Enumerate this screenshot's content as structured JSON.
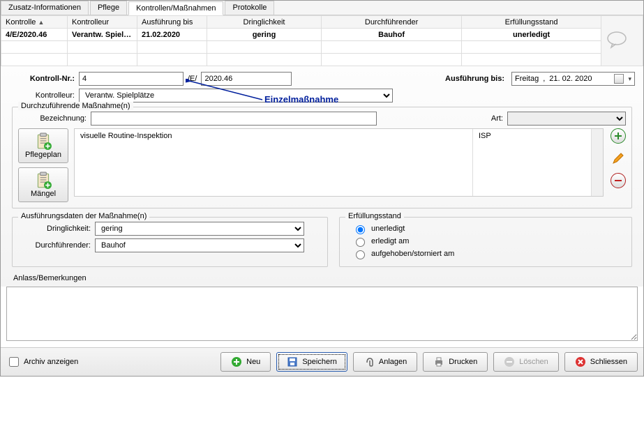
{
  "tabs": {
    "t0": "Zusatz-Informationen",
    "t1": "Pflege",
    "t2": "Kontrollen/Maßnahmen",
    "t3": "Protokolle"
  },
  "grid": {
    "headers": {
      "kontrolle": "Kontrolle",
      "kontrolleur": "Kontrolleur",
      "ausf_bis": "Ausführung bis",
      "dringlichkeit": "Dringlichkeit",
      "durchfuehrender": "Durchführender",
      "erfuellung": "Erfüllungsstand"
    },
    "row": {
      "kontrolle": "4/E/2020.46",
      "kontrolleur": "Verantw. Spiel…",
      "ausf_bis": "21.02.2020",
      "dringlichkeit": "gering",
      "durchfuehrender": "Bauhof",
      "erfuellung": "unerledigt"
    }
  },
  "form": {
    "kontrollnr_label": "Kontroll-Nr.:",
    "kontrollnr_value": "4",
    "kontrollnr_sep": "/E/",
    "kontrollnr_suffix": "2020.46",
    "kontrolleur_label": "Kontrolleur:",
    "kontrolleur_value": "Verantw. Spielplätze",
    "ausf_bis_label": "Ausführung bis:",
    "ausf_bis_day": "Freitag",
    "ausf_bis_date": "21. 02. 2020"
  },
  "annotation": "Einzelmaßnahme",
  "measures": {
    "legend": "Durchzuführende Maßnahme(n)",
    "bez_label": "Bezeichnung:",
    "bez_value": "",
    "art_label": "Art:",
    "art_value": "",
    "list_col1": "visuelle Routine-Inspektion",
    "list_col2": "ISP",
    "btn_pflegeplan": "Pflegeplan",
    "btn_maengel": "Mängel"
  },
  "exec": {
    "legend": "Ausführungsdaten der Maßnahme(n)",
    "dringl_label": "Dringlichkeit:",
    "dringl_value": "gering",
    "durchf_label": "Durchführender:",
    "durchf_value": "Bauhof"
  },
  "fulfil": {
    "legend": "Erfüllungsstand",
    "r1": "unerledigt",
    "r2": "erledigt am",
    "r3": "aufgehoben/storniert am"
  },
  "remarks_label": "Anlass/Bemerkungen",
  "archive_label": "Archiv anzeigen",
  "buttons": {
    "neu": "Neu",
    "speichern": "Speichern",
    "anlagen": "Anlagen",
    "drucken": "Drucken",
    "loeschen": "Löschen",
    "schliessen": "Schliessen"
  }
}
